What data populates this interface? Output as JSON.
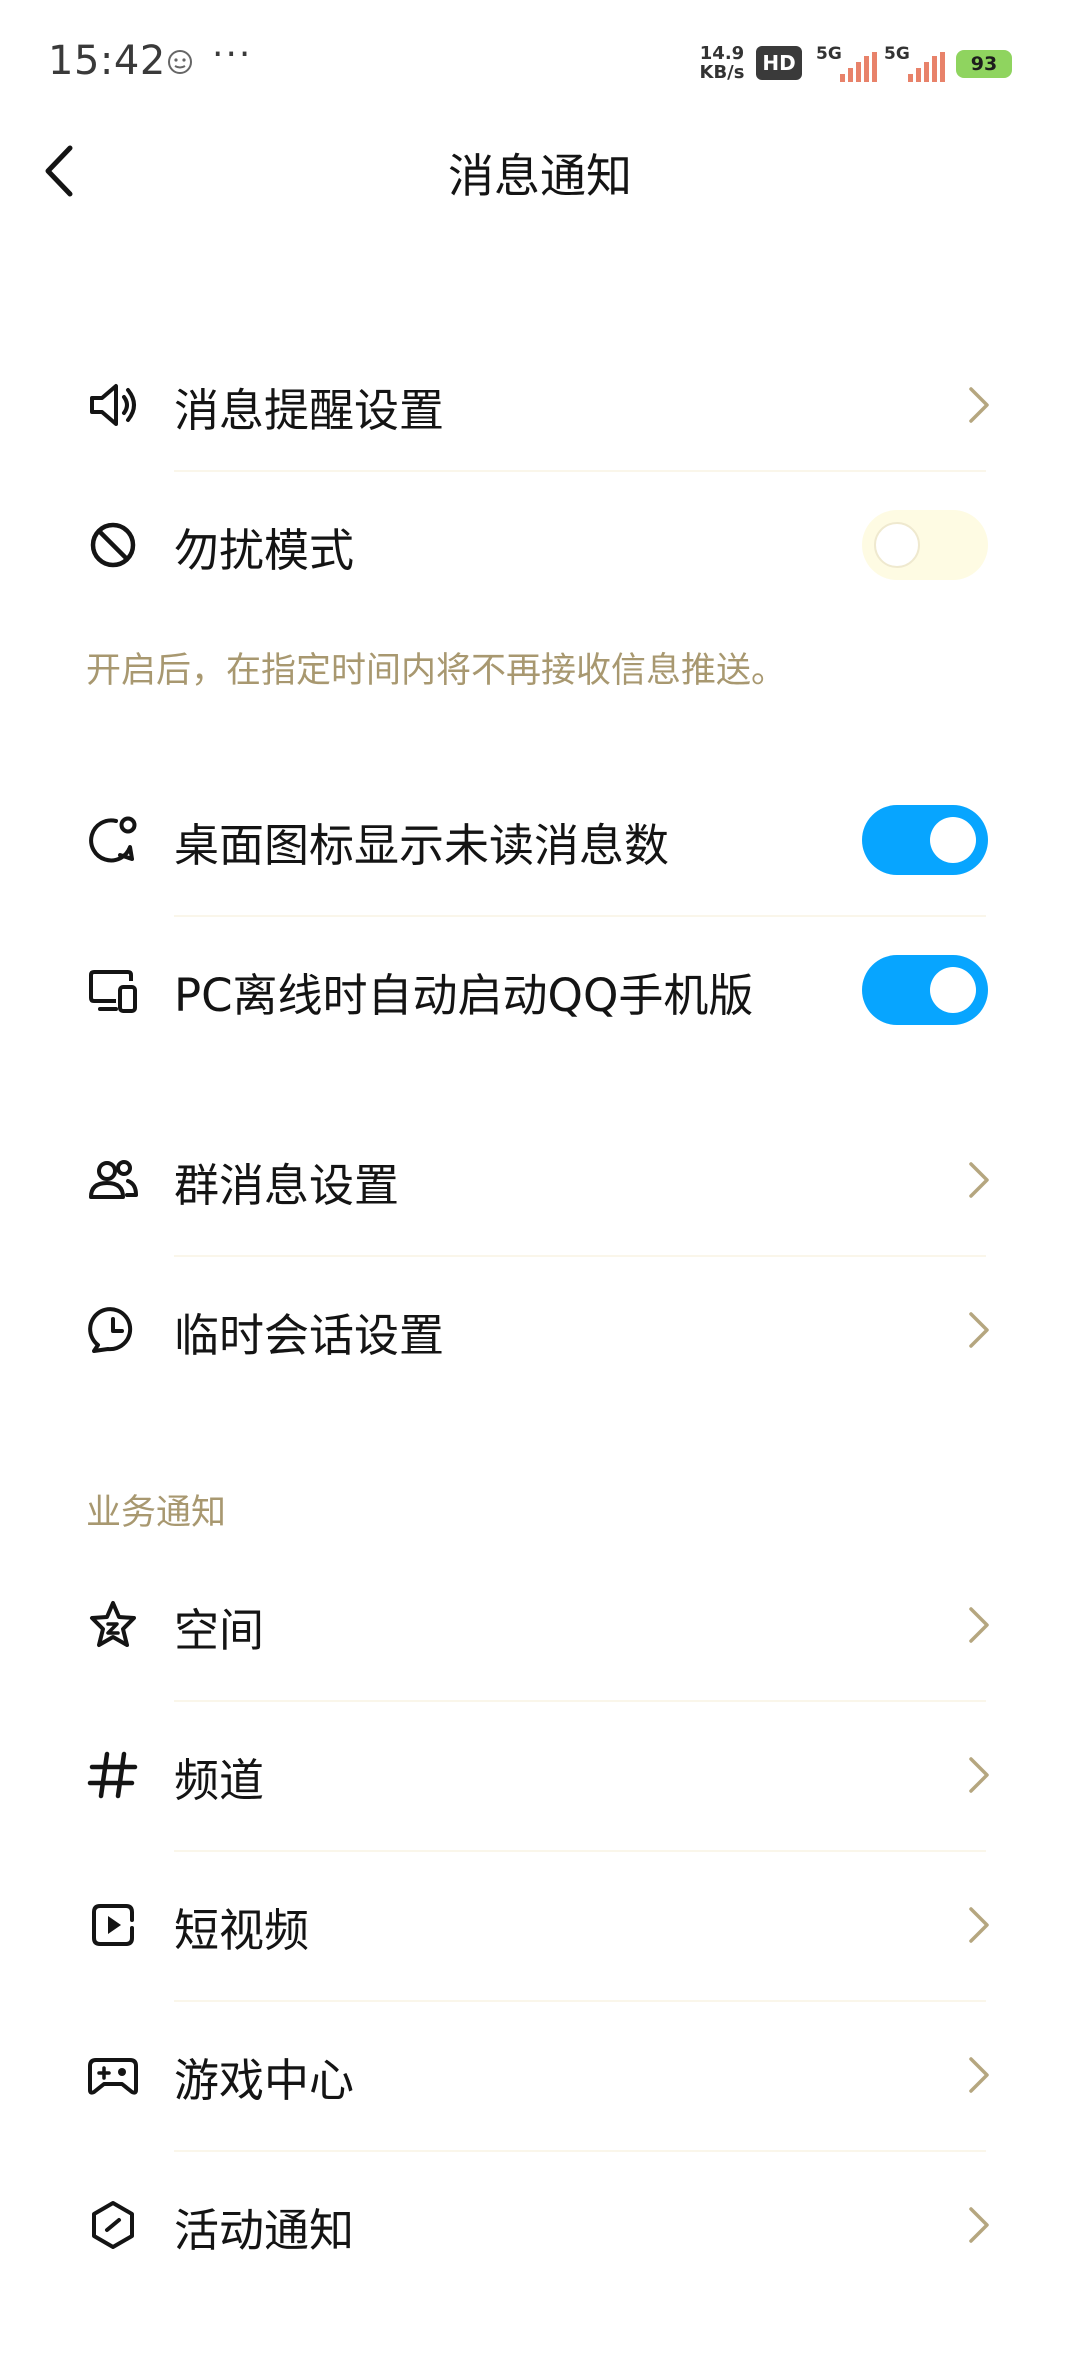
{
  "status_bar": {
    "time": "15:42",
    "more": "···",
    "net_speed_value": "14.9",
    "net_speed_unit": "KB/s",
    "hd_badge": "HD",
    "sim1_label": "5G",
    "sim2_label": "5G",
    "battery": "93"
  },
  "header": {
    "title": "消息通知"
  },
  "rows": {
    "notify_settings": "消息提醒设置",
    "dnd_mode": "勿扰模式",
    "badge_count": "桌面图标显示未读消息数",
    "pc_offline": "PC离线时自动启动QQ手机版",
    "group_settings": "群消息设置",
    "temp_chat": "临时会话设置"
  },
  "toggles": {
    "dnd_mode": false,
    "badge_count": true,
    "pc_offline": true
  },
  "dnd_hint": "开启后，在指定时间内将不再接收信息推送。",
  "business": {
    "section_title": "业务通知",
    "items": {
      "qzone": "空间",
      "channel": "频道",
      "short_video": "短视频",
      "game_center": "游戏中心",
      "activity": "活动通知"
    }
  },
  "icons": {
    "back": "chevron-left-icon",
    "notify_settings": "speaker-icon",
    "dnd_mode": "block-icon",
    "badge_count": "chat-badge-icon",
    "pc_offline": "pc-phone-icon",
    "group_settings": "group-icon",
    "temp_chat": "clock-chat-icon",
    "qzone": "star-icon",
    "channel": "hash-icon",
    "short_video": "video-icon",
    "game_center": "gamepad-icon",
    "activity": "hexagon-icon",
    "row_arrow": "chevron-right-icon"
  },
  "colors": {
    "toggle_on": "#07a5ff",
    "toggle_off": "#fefbe3",
    "hint": "#a89870",
    "chevron": "#b5a67f"
  }
}
